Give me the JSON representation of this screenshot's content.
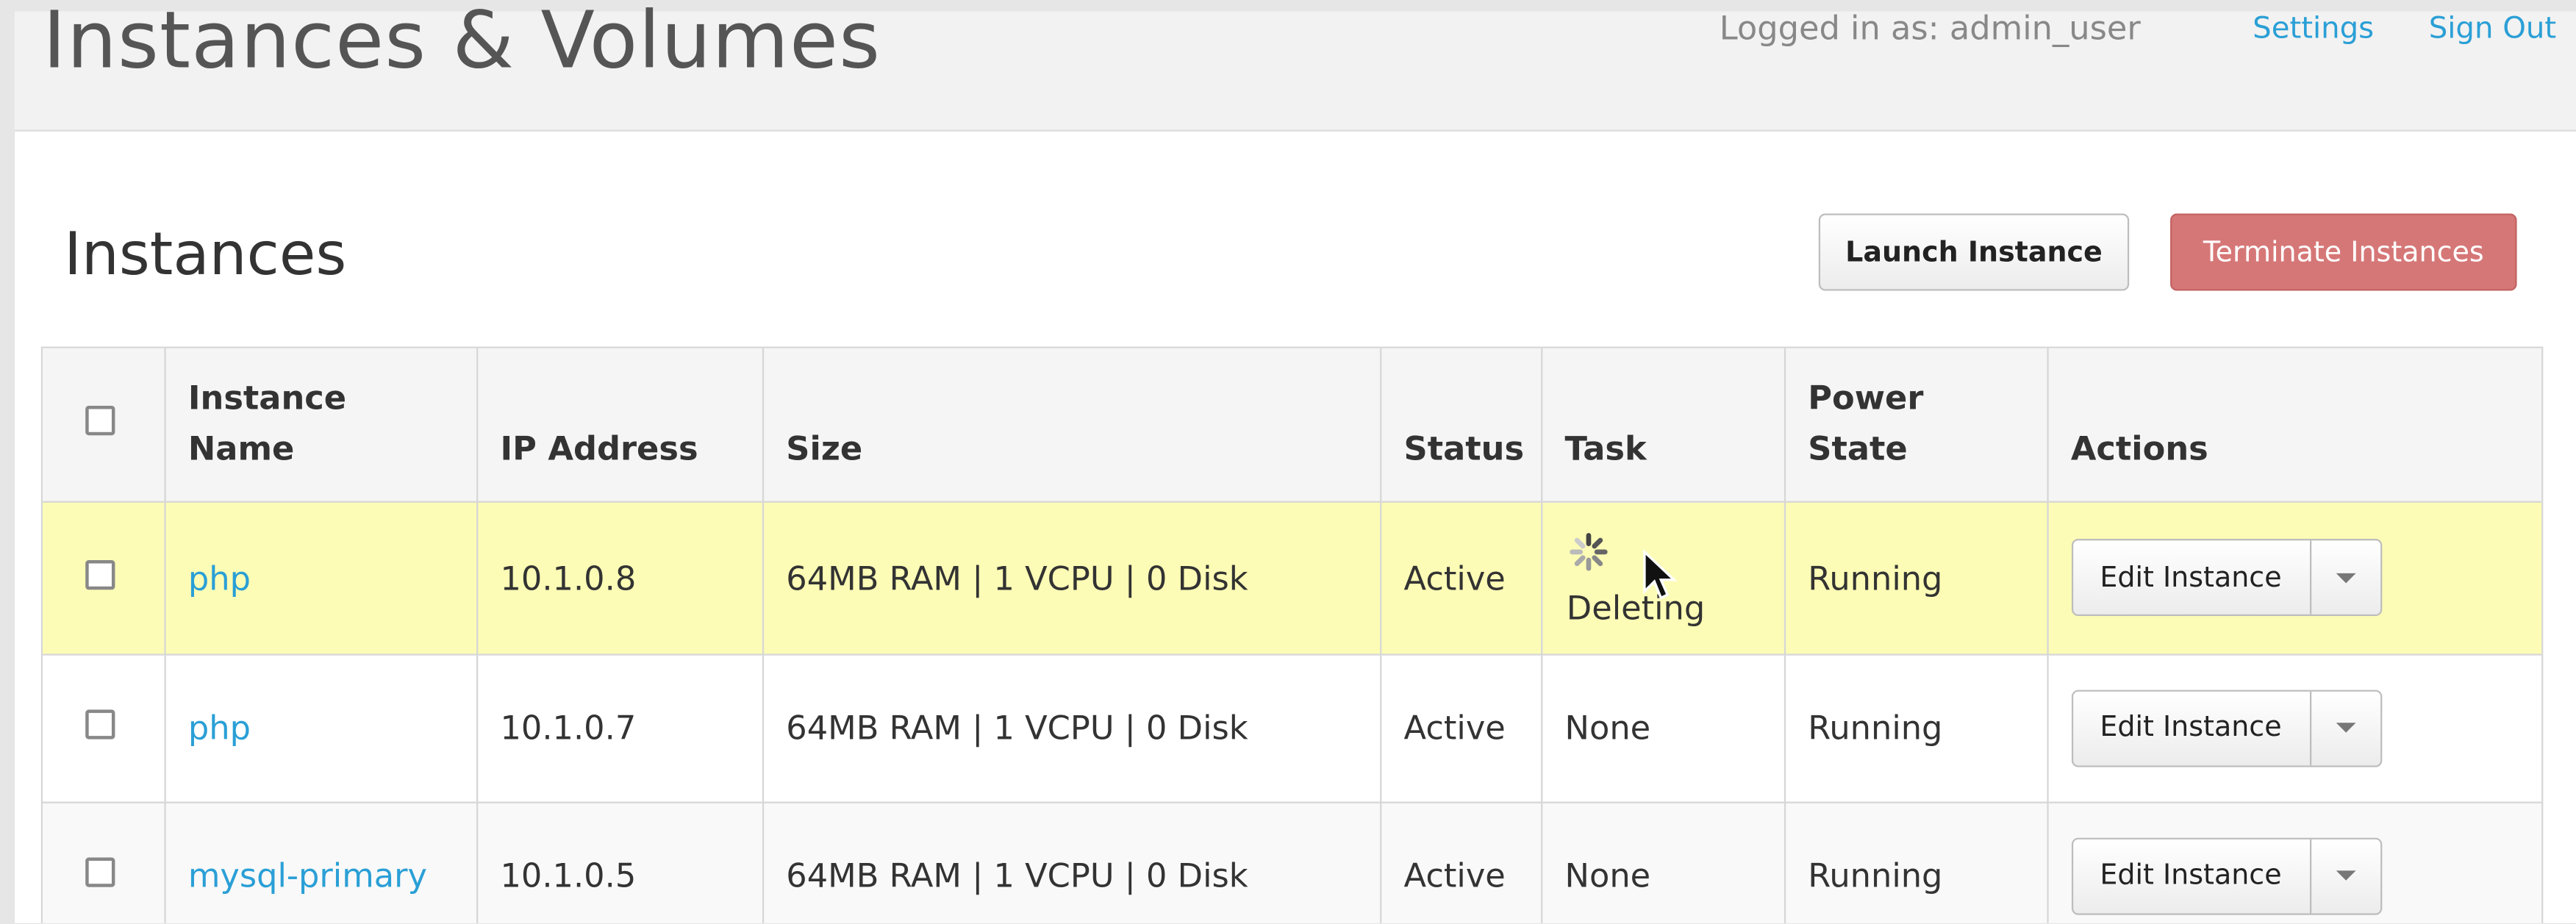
{
  "header": {
    "title": "Instances & Volumes",
    "user_text": "Logged in as: admin_user",
    "settings_label": "Settings",
    "signout_label": "Sign Out"
  },
  "section": {
    "title": "Instances",
    "launch_label": "Launch Instance",
    "terminate_label": "Terminate Instances"
  },
  "table": {
    "columns": [
      "Instance Name",
      "IP Address",
      "Size",
      "Status",
      "Task",
      "Power State",
      "Actions"
    ],
    "rows": [
      {
        "name": "php",
        "ip": "10.1.0.8",
        "size": "64MB RAM | 1 VCPU | 0 Disk",
        "status": "Active",
        "task": "Deleting",
        "power": "Running",
        "action": "Edit Instance"
      },
      {
        "name": "php",
        "ip": "10.1.0.7",
        "size": "64MB RAM | 1 VCPU | 0 Disk",
        "status": "Active",
        "task": "None",
        "power": "Running",
        "action": "Edit Instance"
      },
      {
        "name": "mysql-primary",
        "ip": "10.1.0.5",
        "size": "64MB RAM | 1 VCPU | 0 Disk",
        "status": "Active",
        "task": "None",
        "power": "Running",
        "action": "Edit Instance"
      }
    ]
  },
  "colors": {
    "link": "#2a9fd6",
    "danger": "#d67777",
    "row_highlight": "#fcfcb6"
  },
  "icons": [
    "spinner-icon",
    "mouse-cursor-icon",
    "caret-down-icon"
  ]
}
